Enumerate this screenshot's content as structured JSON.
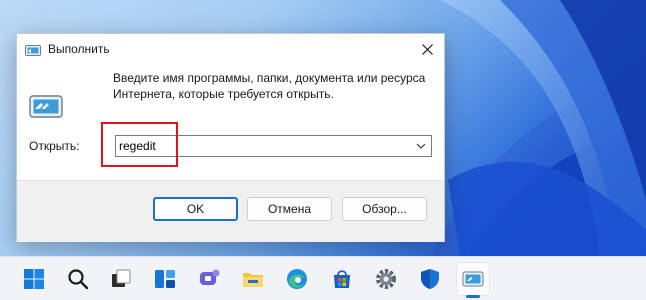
{
  "dialog": {
    "title": "Выполнить",
    "description": "Введите имя программы, папки, документа или ресурса Интернета, которые требуется открыть.",
    "open_label": "Открыть:",
    "command_value": "regedit",
    "buttons": {
      "ok": "OK",
      "cancel": "Отмена",
      "browse": "Обзор..."
    },
    "highlight_color": "#e0141e"
  },
  "taskbar": {
    "items": [
      {
        "icon": "start-icon"
      },
      {
        "icon": "search-icon"
      },
      {
        "icon": "task-view-icon"
      },
      {
        "icon": "widgets-icon"
      },
      {
        "icon": "teams-chat-icon"
      },
      {
        "icon": "file-explorer-icon"
      },
      {
        "icon": "edge-icon"
      },
      {
        "icon": "store-icon"
      },
      {
        "icon": "settings-icon"
      },
      {
        "icon": "security-icon"
      },
      {
        "icon": "run-icon",
        "active": true
      }
    ]
  },
  "colors": {
    "accent": "#1a6fd1",
    "taskbar_bg": "#f2f3f7",
    "wallpaper_blue": "#1547c0"
  }
}
